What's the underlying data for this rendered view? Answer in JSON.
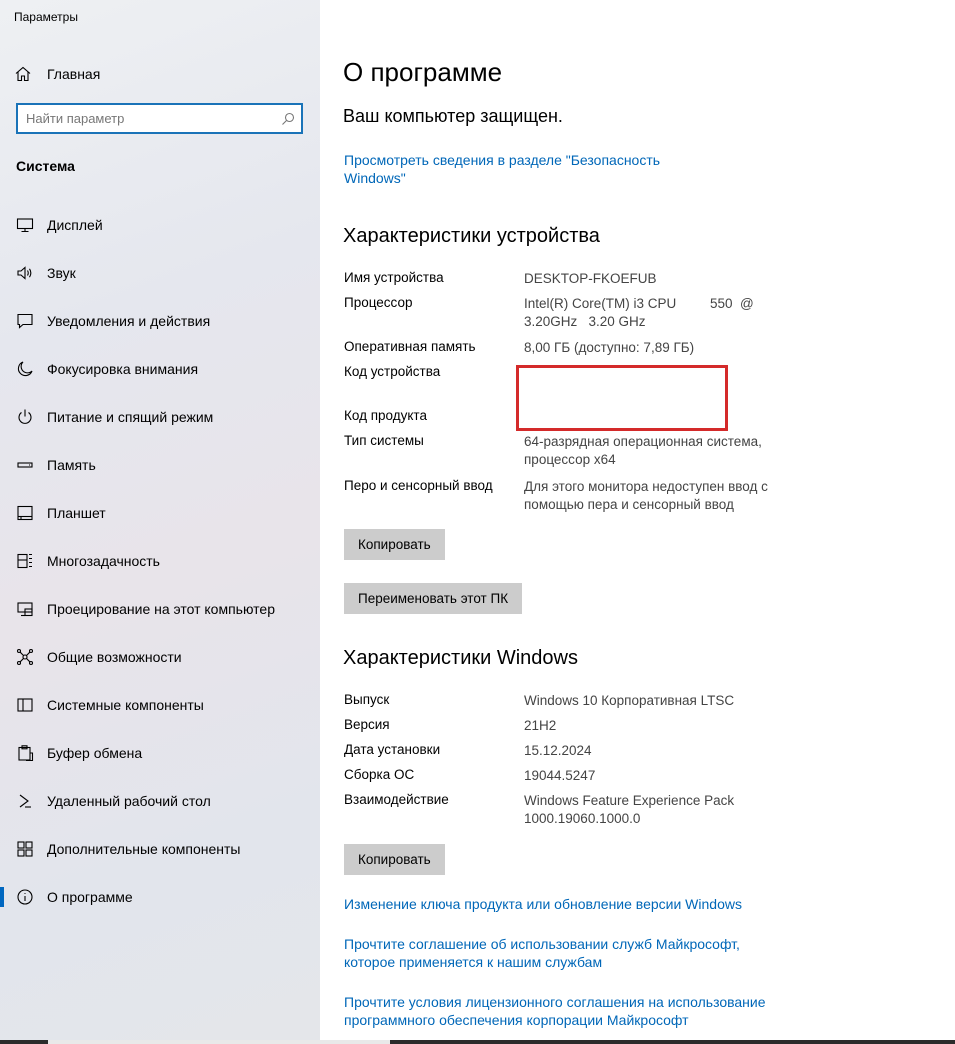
{
  "window": {
    "title": "Параметры"
  },
  "sidebar": {
    "home_label": "Главная",
    "search_placeholder": "Найти параметр",
    "section_title": "Система",
    "items": [
      {
        "label": "Дисплей",
        "icon": "display-icon"
      },
      {
        "label": "Звук",
        "icon": "speaker-icon"
      },
      {
        "label": "Уведомления и действия",
        "icon": "notification-icon"
      },
      {
        "label": "Фокусировка внимания",
        "icon": "moon-icon"
      },
      {
        "label": "Питание и спящий режим",
        "icon": "power-icon"
      },
      {
        "label": "Память",
        "icon": "storage-icon"
      },
      {
        "label": "Планшет",
        "icon": "tablet-icon"
      },
      {
        "label": "Многозадачность",
        "icon": "multitasking-icon"
      },
      {
        "label": "Проецирование на этот компьютер",
        "icon": "projection-icon"
      },
      {
        "label": "Общие возможности",
        "icon": "shared-experiences-icon"
      },
      {
        "label": "Системные компоненты",
        "icon": "system-components-icon"
      },
      {
        "label": "Буфер обмена",
        "icon": "clipboard-icon"
      },
      {
        "label": "Удаленный рабочий стол",
        "icon": "remote-desktop-icon"
      },
      {
        "label": "Дополнительные компоненты",
        "icon": "optional-features-icon"
      },
      {
        "label": "О программе",
        "icon": "info-icon",
        "active": true
      }
    ]
  },
  "main": {
    "title": "О программе",
    "protected_text": "Ваш компьютер защищен.",
    "security_link": "Просмотреть сведения в разделе \"Безопасность Windows\"",
    "device_specs": {
      "heading": "Характеристики устройства",
      "rows": [
        {
          "key": "Имя устройства",
          "value": "DESKTOP-FKOEFUB"
        },
        {
          "key": "Процессор",
          "value": "Intel(R) Core(TM) i3 CPU         550  @ 3.20GHz   3.20 GHz"
        },
        {
          "key": "Оперативная память",
          "value": "8,00 ГБ (доступно: 7,89 ГБ)"
        },
        {
          "key": "Код устройства",
          "value": ""
        },
        {
          "key": "Код продукта",
          "value": ""
        },
        {
          "key": "Тип системы",
          "value": "64-разрядная операционная система, процессор x64"
        },
        {
          "key": "Перо и сенсорный ввод",
          "value": "Для этого монитора недоступен ввод с помощью пера и сенсорный ввод"
        }
      ],
      "copy_button": "Копировать",
      "rename_button": "Переименовать этот ПК"
    },
    "windows_specs": {
      "heading": "Характеристики Windows",
      "rows": [
        {
          "key": "Выпуск",
          "value": "Windows 10 Корпоративная LTSC"
        },
        {
          "key": "Версия",
          "value": "21H2"
        },
        {
          "key": "Дата установки",
          "value": "15.12.2024"
        },
        {
          "key": "Сборка ОС",
          "value": "19044.5247"
        },
        {
          "key": "Взаимодействие",
          "value": "Windows Feature Experience Pack 1000.19060.1000.0"
        }
      ],
      "copy_button": "Копировать"
    },
    "links": [
      "Изменение ключа продукта или обновление версии Windows",
      "Прочтите соглашение об использовании служб Майкрософт, которое применяется к нашим службам",
      "Прочтите условия лицензионного соглашения на использование программного обеспечения корпорации Майкрософт"
    ]
  }
}
